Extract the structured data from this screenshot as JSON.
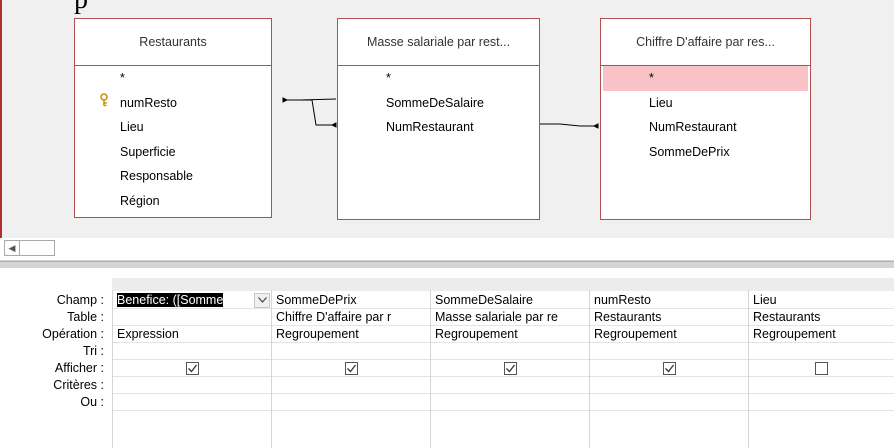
{
  "cut_title": "p",
  "tables": [
    {
      "title": "Restaurants",
      "fields": [
        "*",
        "numResto",
        "Lieu",
        "Superficie",
        "Responsable",
        "Région"
      ],
      "key_field": "numResto"
    },
    {
      "title": "Masse salariale par rest...",
      "fields": [
        "*",
        "SommeDeSalaire",
        "NumRestaurant"
      ]
    },
    {
      "title": "Chiffre D'affaire par res...",
      "fields": [
        "*",
        "Lieu",
        "NumRestaurant",
        "SommeDePrix"
      ],
      "selected_field": "*"
    }
  ],
  "scrollbar": {
    "left_arrow": "◀"
  },
  "row_labels": [
    "Champ :",
    "Table :",
    "Opération :",
    "Tri :",
    "Afficher :",
    "Critères :",
    "Ou :"
  ],
  "columns": [
    {
      "champ": "Benefice: ([Somme",
      "table": "",
      "operation": "Expression",
      "tri": "",
      "afficher": true,
      "criteres": "",
      "ou": "",
      "editing": true
    },
    {
      "champ": "SommeDePrix",
      "table": "Chiffre D'affaire par r",
      "operation": "Regroupement",
      "tri": "",
      "afficher": true,
      "criteres": "",
      "ou": ""
    },
    {
      "champ": "SommeDeSalaire",
      "table": "Masse salariale par re",
      "operation": "Regroupement",
      "tri": "",
      "afficher": true,
      "criteres": "",
      "ou": ""
    },
    {
      "champ": "numResto",
      "table": "Restaurants",
      "operation": "Regroupement",
      "tri": "",
      "afficher": true,
      "criteres": "",
      "ou": ""
    },
    {
      "champ": "Lieu",
      "table": "Restaurants",
      "operation": "Regroupement",
      "tri": "",
      "afficher": false,
      "criteres": "",
      "ou": ""
    }
  ],
  "icons": {
    "key": "key-icon",
    "dropdown": "chevron-down-icon",
    "check": "checkbox-icon"
  },
  "colors": {
    "table_border": "#b05050",
    "selected_field": "#f8c2c6",
    "key": "#c8960c"
  }
}
